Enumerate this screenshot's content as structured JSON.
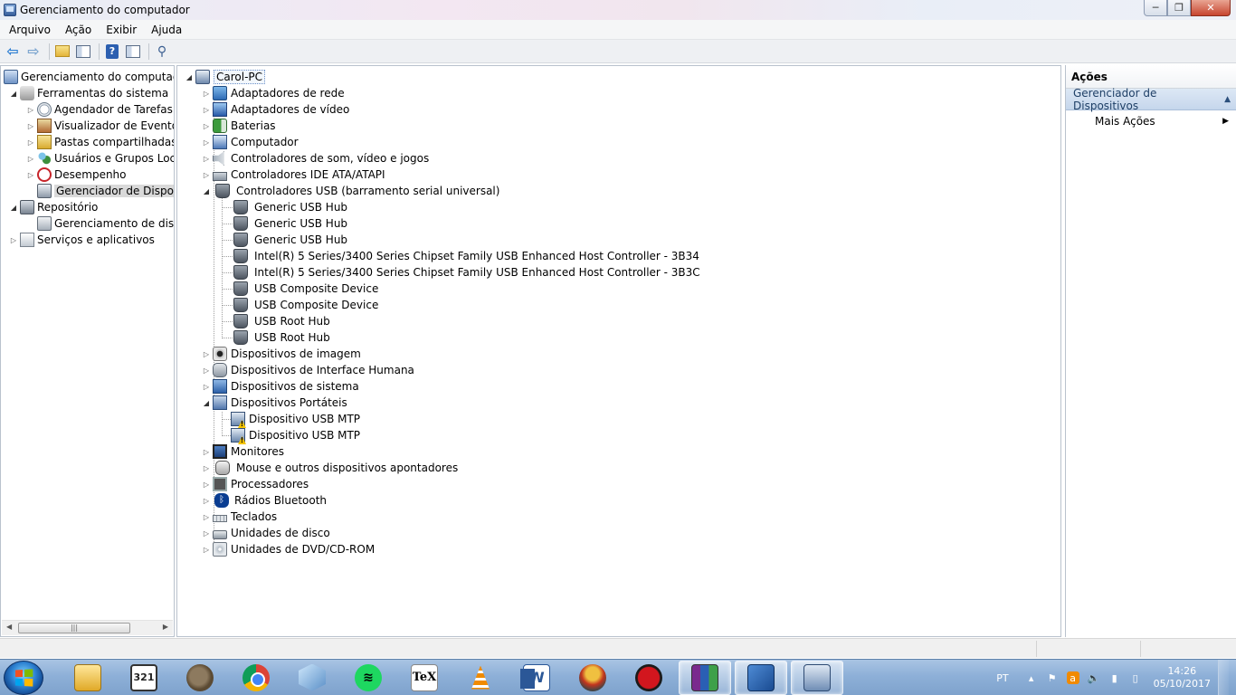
{
  "window": {
    "title": "Gerenciamento do computador",
    "controls": {
      "minimize": "─",
      "maximize": "❐",
      "close": "✕"
    }
  },
  "menubar": {
    "items": [
      "Arquivo",
      "Ação",
      "Exibir",
      "Ajuda"
    ]
  },
  "toolbar": {
    "icons": [
      "back-arrow-icon",
      "forward-arrow-icon",
      "up-folder-icon",
      "show-hide-tree-icon",
      "help-icon",
      "show-hide-action-pane-icon",
      "properties-icon"
    ]
  },
  "left_tree": {
    "items": [
      {
        "label": "Gerenciamento do computado",
        "level": 0,
        "expander": "",
        "icon": "computer-management-icon"
      },
      {
        "label": "Ferramentas do sistema",
        "level": 1,
        "expander": "open",
        "icon": "system-tools-icon"
      },
      {
        "label": "Agendador de Tarefas",
        "level": 2,
        "expander": "closed",
        "icon": "task-scheduler-icon"
      },
      {
        "label": "Visualizador de Eventos",
        "level": 2,
        "expander": "closed",
        "icon": "event-viewer-icon"
      },
      {
        "label": "Pastas compartilhadas",
        "level": 2,
        "expander": "closed",
        "icon": "shared-folders-icon"
      },
      {
        "label": "Usuários e Grupos Loca",
        "level": 2,
        "expander": "closed",
        "icon": "users-groups-icon"
      },
      {
        "label": "Desempenho",
        "level": 2,
        "expander": "closed",
        "icon": "performance-icon"
      },
      {
        "label": "Gerenciador de Disposit",
        "level": 2,
        "expander": "",
        "icon": "device-manager-icon",
        "selected": true
      },
      {
        "label": "Repositório",
        "level": 1,
        "expander": "open",
        "icon": "storage-icon"
      },
      {
        "label": "Gerenciamento de disco",
        "level": 2,
        "expander": "",
        "icon": "disk-management-icon"
      },
      {
        "label": "Serviços e aplicativos",
        "level": 1,
        "expander": "closed",
        "icon": "services-apps-icon"
      }
    ]
  },
  "device_tree": {
    "root": "Carol-PC",
    "categories": [
      {
        "label": "Adaptadores de rede",
        "icon": "network-adapter-icon",
        "expanded": false
      },
      {
        "label": "Adaptadores de vídeo",
        "icon": "display-adapter-icon",
        "expanded": false
      },
      {
        "label": "Baterias",
        "icon": "battery-icon",
        "expanded": false
      },
      {
        "label": "Computador",
        "icon": "computer-icon",
        "expanded": false
      },
      {
        "label": "Controladores de som, vídeo e jogos",
        "icon": "sound-icon",
        "expanded": false
      },
      {
        "label": "Controladores IDE ATA/ATAPI",
        "icon": "ide-controller-icon",
        "expanded": false
      },
      {
        "label": "Controladores USB (barramento serial universal)",
        "icon": "usb-icon",
        "expanded": true,
        "children": [
          "Generic USB Hub",
          "Generic USB Hub",
          "Generic USB Hub",
          "Intel(R) 5 Series/3400 Series Chipset Family USB Enhanced Host Controller - 3B34",
          "Intel(R) 5 Series/3400 Series Chipset Family USB Enhanced Host Controller - 3B3C",
          "USB Composite Device",
          "USB Composite Device",
          "USB Root Hub",
          "USB Root Hub"
        ]
      },
      {
        "label": "Dispositivos de imagem",
        "icon": "imaging-device-icon",
        "expanded": false
      },
      {
        "label": "Dispositivos de Interface Humana",
        "icon": "hid-icon",
        "expanded": false
      },
      {
        "label": "Dispositivos de sistema",
        "icon": "system-devices-icon",
        "expanded": false
      },
      {
        "label": "Dispositivos Portáteis",
        "icon": "portable-devices-icon",
        "expanded": true,
        "children": [
          "Dispositivo USB MTP",
          "Dispositivo USB MTP"
        ]
      },
      {
        "label": "Monitores",
        "icon": "monitor-icon",
        "expanded": false
      },
      {
        "label": "Mouse e outros dispositivos apontadores",
        "icon": "mouse-icon",
        "expanded": false
      },
      {
        "label": "Processadores",
        "icon": "processor-icon",
        "expanded": false
      },
      {
        "label": "Rádios Bluetooth",
        "icon": "bluetooth-icon",
        "expanded": false
      },
      {
        "label": "Teclados",
        "icon": "keyboard-icon",
        "expanded": false
      },
      {
        "label": "Unidades de disco",
        "icon": "disk-drive-icon",
        "expanded": false
      },
      {
        "label": "Unidades de DVD/CD-ROM",
        "icon": "dvd-drive-icon",
        "expanded": false
      }
    ]
  },
  "actions_pane": {
    "header": "Ações",
    "section": "Gerenciador de Dispositivos",
    "items": [
      "Mais Ações"
    ]
  },
  "taskbar": {
    "apps": [
      {
        "name": "explorer",
        "icon": "windows-explorer-icon",
        "glyph": ""
      },
      {
        "name": "media-player-classic",
        "icon": "media-player-321-icon",
        "glyph": "321"
      },
      {
        "name": "gimp",
        "icon": "gimp-icon",
        "glyph": ""
      },
      {
        "name": "chrome",
        "icon": "chrome-icon",
        "glyph": ""
      },
      {
        "name": "virtualbox",
        "icon": "virtualbox-icon",
        "glyph": ""
      },
      {
        "name": "spotify",
        "icon": "spotify-icon",
        "glyph": "≋"
      },
      {
        "name": "texworks",
        "icon": "tex-icon",
        "glyph": "TeX"
      },
      {
        "name": "vlc",
        "icon": "vlc-icon",
        "glyph": ""
      },
      {
        "name": "word",
        "icon": "word-icon",
        "glyph": "W"
      },
      {
        "name": "robot-app",
        "icon": "robot-app-icon",
        "glyph": ""
      },
      {
        "name": "red-app",
        "icon": "red-circle-app-icon",
        "glyph": ""
      },
      {
        "name": "winrar",
        "icon": "winrar-icon",
        "glyph": ""
      },
      {
        "name": "tools",
        "icon": "tools-app-icon",
        "glyph": ""
      },
      {
        "name": "computer-management",
        "icon": "computer-management-task-icon",
        "glyph": ""
      }
    ],
    "active_app": "computer-management",
    "tray": {
      "language": "PT",
      "time": "14:26",
      "date": "05/10/2017"
    }
  },
  "colors": {
    "selection": "#d9d9d9",
    "action_section_bg": "#c5d6ec",
    "taskbar": "#8eb0d8"
  }
}
